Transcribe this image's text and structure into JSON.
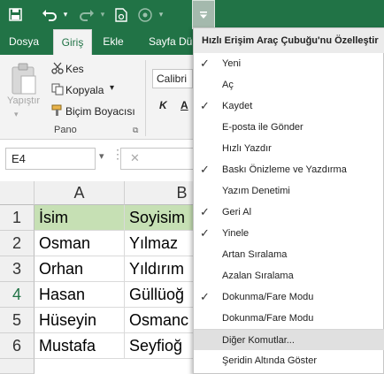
{
  "qat": {
    "icons": [
      "save-icon",
      "undo-icon",
      "undo-dropdown-icon",
      "redo-icon",
      "redo-dropdown-icon",
      "print-preview-icon",
      "touch-mode-icon",
      "touch-dropdown-icon",
      "customize-qat-icon"
    ]
  },
  "tabs": [
    {
      "label": "Dosya"
    },
    {
      "label": "Giriş"
    },
    {
      "label": "Ekle"
    },
    {
      "label": "Sayfa Dü"
    }
  ],
  "ribbon": {
    "paste_label": "Yapıştır",
    "cut_label": "Kes",
    "copy_label": "Kopyala",
    "format_painter_label": "Biçim Boyacısı",
    "clipboard_group_label": "Pano",
    "font_name": "Calibri",
    "italic_label": "K"
  },
  "formula": {
    "namebox": "E4"
  },
  "grid": {
    "columns": [
      "A",
      "B"
    ],
    "rows": [
      {
        "num": "1",
        "a": "İsim",
        "b": "Soyisim"
      },
      {
        "num": "2",
        "a": "Osman",
        "b": "Yılmaz"
      },
      {
        "num": "3",
        "a": "Orhan",
        "b": "Yıldırım"
      },
      {
        "num": "4",
        "a": "Hasan",
        "b": "Güllüoğ"
      },
      {
        "num": "5",
        "a": "Hüseyin",
        "b": "Osmanc"
      },
      {
        "num": "6",
        "a": "Mustafa",
        "b": "Seyfioğ"
      }
    ],
    "header_fill": "#c6e0b4"
  },
  "menu": {
    "title": "Hızlı Erişim Araç Çubuğu'nu Özelleştir",
    "items": [
      {
        "label": "Yeni",
        "checked": true
      },
      {
        "label": "Aç",
        "checked": false
      },
      {
        "label": "Kaydet",
        "checked": true
      },
      {
        "label": "E-posta ile Gönder",
        "checked": false
      },
      {
        "label": "Hızlı Yazdır",
        "checked": false
      },
      {
        "label": "Baskı Önizleme ve Yazdırma",
        "checked": true
      },
      {
        "label": "Yazım Denetimi",
        "checked": false
      },
      {
        "label": "Geri Al",
        "checked": true
      },
      {
        "label": "Yinele",
        "checked": true
      },
      {
        "label": "Artan Sıralama",
        "checked": false
      },
      {
        "label": "Azalan Sıralama",
        "checked": false
      },
      {
        "label": "Dokunma/Fare Modu",
        "checked": true
      },
      {
        "label": "Dokunma/Fare Modu",
        "checked": false
      },
      {
        "label": "Diğer Komutlar...",
        "checked": false,
        "highlighted": true
      },
      {
        "label": "Şeridin Altında Göster",
        "checked": false
      }
    ]
  },
  "colors": {
    "accent": "#217346",
    "check_mark": "✓"
  }
}
